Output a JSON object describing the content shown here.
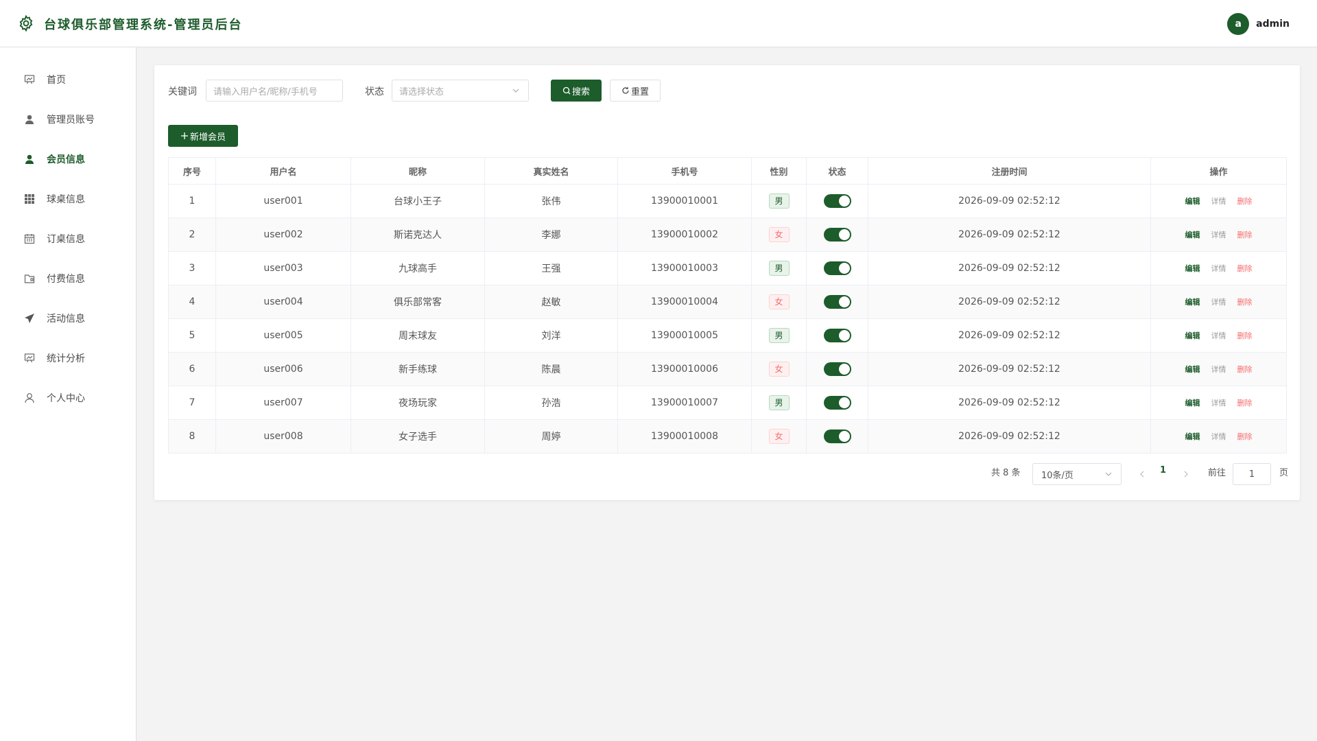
{
  "header": {
    "title": "台球俱乐部管理系统-管理员后台",
    "avatar_letter": "a",
    "username": "admin"
  },
  "sidebar": {
    "items": [
      {
        "label": "首页",
        "icon": "chart-board-icon",
        "active": false
      },
      {
        "label": "管理员账号",
        "icon": "user-icon",
        "active": false
      },
      {
        "label": "会员信息",
        "icon": "user-icon",
        "active": true
      },
      {
        "label": "球桌信息",
        "icon": "grid-icon",
        "active": false
      },
      {
        "label": "订桌信息",
        "icon": "calendar-icon",
        "active": false
      },
      {
        "label": "付费信息",
        "icon": "folder-icon",
        "active": false
      },
      {
        "label": "活动信息",
        "icon": "send-icon",
        "active": false
      },
      {
        "label": "统计分析",
        "icon": "chart-board-icon",
        "active": false
      },
      {
        "label": "个人中心",
        "icon": "person-outline-icon",
        "active": false
      }
    ]
  },
  "filters": {
    "keyword_label": "关键词",
    "keyword_placeholder": "请输入用户名/昵称/手机号",
    "status_label": "状态",
    "status_placeholder": "请选择状态",
    "search_button": "搜索",
    "reset_button": "重置"
  },
  "add_button": "新增会员",
  "table": {
    "headers": [
      "序号",
      "用户名",
      "昵称",
      "真实姓名",
      "手机号",
      "性别",
      "状态",
      "注册时间",
      "操作"
    ],
    "actions": {
      "edit": "编辑",
      "detail": "详情",
      "delete": "删除"
    },
    "rows": [
      {
        "no": "1",
        "username": "user001",
        "nickname": "台球小王子",
        "realname": "张伟",
        "phone": "13900010001",
        "gender": "男",
        "enabled": true,
        "registered": "2026-09-09 02:52:12"
      },
      {
        "no": "2",
        "username": "user002",
        "nickname": "斯诺克达人",
        "realname": "李娜",
        "phone": "13900010002",
        "gender": "女",
        "enabled": true,
        "registered": "2026-09-09 02:52:12"
      },
      {
        "no": "3",
        "username": "user003",
        "nickname": "九球高手",
        "realname": "王强",
        "phone": "13900010003",
        "gender": "男",
        "enabled": true,
        "registered": "2026-09-09 02:52:12"
      },
      {
        "no": "4",
        "username": "user004",
        "nickname": "俱乐部常客",
        "realname": "赵敏",
        "phone": "13900010004",
        "gender": "女",
        "enabled": true,
        "registered": "2026-09-09 02:52:12"
      },
      {
        "no": "5",
        "username": "user005",
        "nickname": "周末球友",
        "realname": "刘洋",
        "phone": "13900010005",
        "gender": "男",
        "enabled": true,
        "registered": "2026-09-09 02:52:12"
      },
      {
        "no": "6",
        "username": "user006",
        "nickname": "新手练球",
        "realname": "陈晨",
        "phone": "13900010006",
        "gender": "女",
        "enabled": true,
        "registered": "2026-09-09 02:52:12"
      },
      {
        "no": "7",
        "username": "user007",
        "nickname": "夜场玩家",
        "realname": "孙浩",
        "phone": "13900010007",
        "gender": "男",
        "enabled": true,
        "registered": "2026-09-09 02:52:12"
      },
      {
        "no": "8",
        "username": "user008",
        "nickname": "女子选手",
        "realname": "周婷",
        "phone": "13900010008",
        "gender": "女",
        "enabled": true,
        "registered": "2026-09-09 02:52:12"
      }
    ]
  },
  "pagination": {
    "total_text": "共 8 条",
    "page_size": "10条/页",
    "current_page": "1",
    "goto_label": "前往",
    "goto_value": "1",
    "page_suffix": "页"
  },
  "colors": {
    "primary": "#1d5c2b",
    "danger": "#f56c6c"
  }
}
